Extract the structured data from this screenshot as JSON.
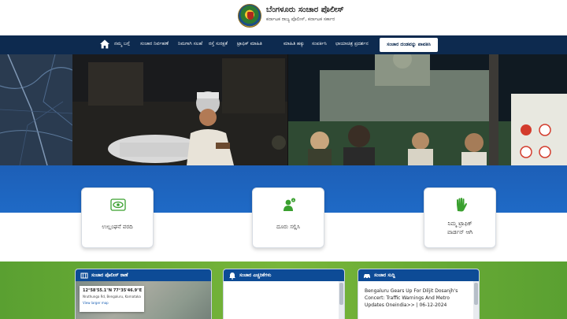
{
  "header": {
    "title": "ಬೆಂಗಳೂರು ಸಂಚಾರ ಪೊಲೀಸ್",
    "subtitle": "ಕರ್ನಾಟಕ ರಾಜ್ಯ ಪೊಲೀಸ್, ಕರ್ನಾಟಕ ಸರ್ಕಾರ"
  },
  "nav": {
    "items": [
      "ನಮ್ಮ ಬಗ್ಗೆ",
      "ಸಂಚಾರ ನಿರ್ವಹಣೆ",
      "ನಿಮಗಾಗಿ ಸಲಹೆ",
      "ರಸ್ತೆ ಸುರಕ್ಷತೆ",
      "ಟ್ರಾಫಿಕ್ ಮಾಹಿತಿ",
      "ಮಾಹಿತಿ ಹಕ್ಕು",
      "ಸಂಪರ್ಕಿಸಿ",
      "ಛಾಯಾಚಿತ್ರ ಪ್ರದರ್ಶನ"
    ],
    "button_label": "ಸಂಚಾರ ದಂಡವನ್ನು ಪಾವತಿಸಿ"
  },
  "cards": [
    {
      "label_line1": "ಉಲ್ಲಂಘನೆ ವರದಿ",
      "label_line2": "",
      "icon": "eye-report-icon"
    },
    {
      "label_line1": "ದೂರು ಸಲ್ಲಿಸಿ",
      "label_line2": "",
      "icon": "complaint-person-icon"
    },
    {
      "label_line1": "ನಿಮ್ಮ ಟ್ರಾಫಿಕ್",
      "label_line2": "ವಾರ್ಡನ್ ಆಗಿ",
      "icon": "hand-icon"
    }
  ],
  "panels": {
    "location": {
      "title": "ಸಂಚಾರ ಪೊಲೀಸ್ ಠಾಣೆ",
      "coords": "12°58'55.1\"N 77°35'46.9\"E",
      "address": "Nruthunga Rd, Bengaluru, Karnataka",
      "link": "View larger map"
    },
    "alerts": {
      "title": "ಸಂಚಾರ ಎಚ್ಚರಿಕೆಗಳು"
    },
    "news": {
      "title": "ಸಂಚಾರ ಸುದ್ದಿ",
      "text": "Bengaluru Gears Up For Diljit Dosanjh's Concert: Traffic Warnings And Metro Updates Oneindia>> | 06-12-2024"
    }
  },
  "colors": {
    "nav": "#0d2a4f",
    "blue_band": "#1f6ac6",
    "green": "#6aab36",
    "panel_head": "#0d4b96"
  }
}
